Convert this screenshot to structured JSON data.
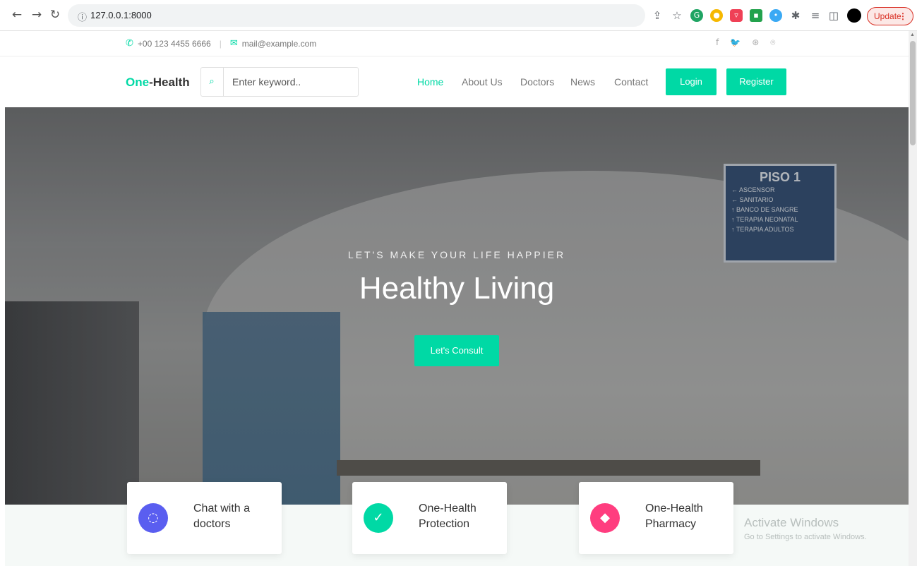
{
  "browser": {
    "url": "127.0.0.1:8000",
    "update_label": "Update",
    "menu_dots": "⋮"
  },
  "topbar": {
    "phone": "+00 123 4455 6666",
    "email": "mail@example.com",
    "social": [
      "f",
      "🐦",
      "⊛",
      "⌾"
    ]
  },
  "navbar": {
    "brand_accent": "One",
    "brand_rest": "-Health",
    "search_placeholder": "Enter keyword..",
    "links": [
      "Home",
      "About Us",
      "Doctors",
      "News",
      "Contact"
    ],
    "login_label": "Login",
    "register_label": "Register"
  },
  "hero": {
    "kicker": "LET'S MAKE YOUR LIFE HAPPIER",
    "title": "Healthy Living",
    "cta_label": "Let's Consult",
    "sign": {
      "title": "PISO 1",
      "lines": [
        "← ASCENSOR",
        "← SANITARIO",
        "↑ BANCO DE SANGRE",
        "↑ TERAPIA NEONATAL",
        "↑ TERAPIA ADULTOS"
      ]
    }
  },
  "features": [
    {
      "label": "Chat with a doctors",
      "icon": "chat-icon",
      "color": "#5a5ef0"
    },
    {
      "label": "One-Health Protection",
      "icon": "shield-check-icon",
      "color": "#00d9a5"
    },
    {
      "label": "One-Health Pharmacy",
      "icon": "basket-icon",
      "color": "#ff3d7f"
    }
  ],
  "watermark": {
    "title": "Activate Windows",
    "subtitle": "Go to Settings to activate Windows."
  },
  "colors": {
    "accent": "#00d9a5",
    "text": "#333333"
  }
}
